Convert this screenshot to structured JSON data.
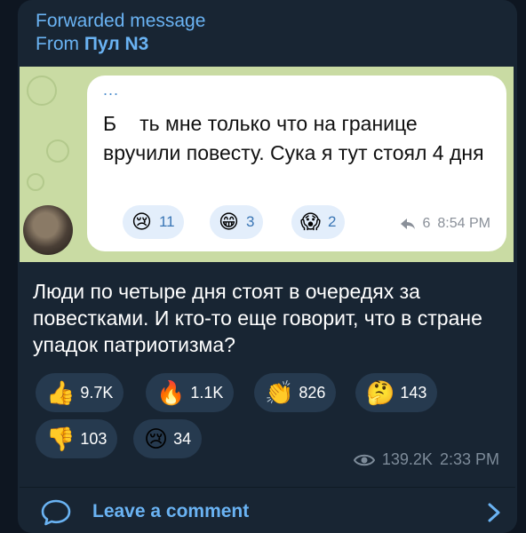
{
  "forward": {
    "label": "Forwarded message",
    "from_prefix": "From",
    "from_name": "Пул N3"
  },
  "embedded_screenshot": {
    "dots": "...",
    "text_part1": "Б",
    "text_part2": "ть мне только что на границе вручили повесту. Сука я тут стоял 4 дня",
    "reactions": [
      {
        "icon": "crying-face",
        "emoji": "😢",
        "count": "11"
      },
      {
        "icon": "grinning-face",
        "emoji": "😁",
        "count": "3"
      },
      {
        "icon": "screaming-face",
        "emoji": "😱",
        "count": "2"
      }
    ],
    "forward_count": "6",
    "time": "8:54 PM"
  },
  "caption": "Люди по четыре дня стоят в очередях за повестками. И кто-то еще говорит, что в стране упадок патриотизма?",
  "reactions": [
    {
      "icon": "thumbs-up",
      "emoji": "👍",
      "count": "9.7K"
    },
    {
      "icon": "fire",
      "emoji": "🔥",
      "count": "1.1K"
    },
    {
      "icon": "clapping-hands",
      "emoji": "👏",
      "count": "826"
    },
    {
      "icon": "thinking-face",
      "emoji": "🤔",
      "count": "143"
    },
    {
      "icon": "thumbs-down",
      "emoji": "👎",
      "count": "103"
    },
    {
      "icon": "crying-face",
      "emoji": "😢",
      "count": "34"
    }
  ],
  "meta": {
    "views": "139.2K",
    "time": "2:33 PM"
  },
  "comment": {
    "label": "Leave a comment"
  },
  "colors": {
    "background": "#0e1621",
    "bubble": "#182533",
    "accent": "#6ab3f3",
    "reaction_pill": "#263a4f"
  }
}
